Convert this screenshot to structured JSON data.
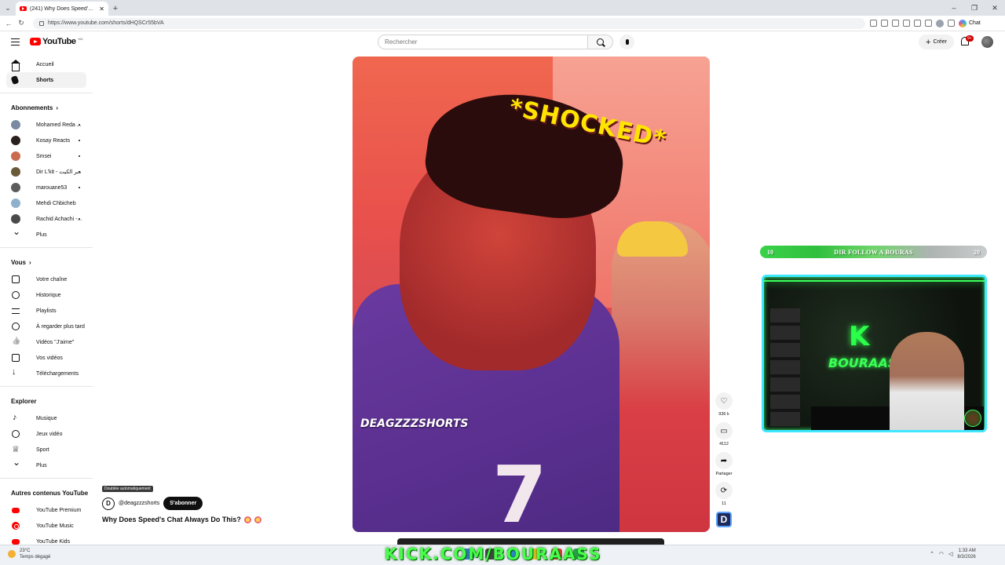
{
  "browser": {
    "tab_title": "(241) Why Does Speed's Chat Always Do This?",
    "url": "https://www.youtube.com/shorts/dHQSCr55bVA",
    "copilot_label": "Chat"
  },
  "header": {
    "logo_text": "YouTube",
    "logo_region": "MA",
    "search_placeholder": "Rechercher",
    "create_label": "Créer",
    "notif_count": "9+"
  },
  "sidebar": {
    "main": [
      {
        "label": "Accueil",
        "icon": "home-icon"
      },
      {
        "label": "Shorts",
        "icon": "shorts-icon"
      }
    ],
    "subs_heading": "Abonnements",
    "subscriptions": [
      {
        "label": "Mohamed Reda ...",
        "color": "#7a8aa0",
        "dot": true
      },
      {
        "label": "Kosay Reacts",
        "color": "#2a1f1f",
        "dot": true
      },
      {
        "label": "Smsei",
        "color": "#c86b4f",
        "dot": true
      },
      {
        "label": "Dir L'kit - دير الكيت",
        "color": "#6b5a3a",
        "dot": true
      },
      {
        "label": "marouane53",
        "color": "#5b5b5b",
        "dot": true
      },
      {
        "label": "Mehdi Chbicheb",
        "color": "#8fb0cc",
        "dot": false
      },
      {
        "label": "Rachid Achachi -...",
        "color": "#4a4a4a",
        "dot": true
      }
    ],
    "subs_more": "Plus",
    "you_heading": "Vous",
    "you_items": [
      {
        "label": "Votre chaîne",
        "icon": "person-icon"
      },
      {
        "label": "Historique",
        "icon": "history-icon"
      },
      {
        "label": "Playlists",
        "icon": "playlists-icon"
      },
      {
        "label": "À regarder plus tard",
        "icon": "clock-icon"
      },
      {
        "label": "Vidéos \"J'aime\"",
        "icon": "thumbs-up-icon"
      },
      {
        "label": "Vos vidéos",
        "icon": "video-icon"
      },
      {
        "label": "Téléchargements",
        "icon": "download-icon"
      }
    ],
    "explore_heading": "Explorer",
    "explore_items": [
      {
        "label": "Musique",
        "icon": "music-icon"
      },
      {
        "label": "Jeux vidéo",
        "icon": "gaming-icon"
      },
      {
        "label": "Sport",
        "icon": "trophy-icon"
      }
    ],
    "explore_more": "Plus",
    "other_heading": "Autres contenus YouTube",
    "other_items": [
      {
        "label": "YouTube Premium",
        "icon": "youtube-premium-icon"
      },
      {
        "label": "YouTube Music",
        "icon": "youtube-music-icon"
      },
      {
        "label": "YouTube Kids",
        "icon": "youtube-kids-icon"
      }
    ]
  },
  "short": {
    "overlay_caption": "*SHOCKED*",
    "watermark": "DEAGZZZSHORTS",
    "jersey_number": "7",
    "dub_tag": "Doublée automatiquement",
    "channel_handle": "@deagzzzshorts",
    "subscribe_label": "S'abonner",
    "title": "Why Does Speed's Chat Always Do This?",
    "likes": "936 k",
    "comments": "4112",
    "share_label": "Partager",
    "remix_count": "11"
  },
  "overlay": {
    "goal_left": "10",
    "goal_text": "DIR FOLLOW A BOURAS",
    "goal_right": "20",
    "cam_logo": "K",
    "cam_name": "BOURAASS",
    "kick_banner": "KICK.COM/BOURAASS"
  },
  "taskbar": {
    "temperature": "23°C",
    "weather_desc": "Temps dégagé",
    "time": "1:33 AM",
    "date": "8/3/2026"
  }
}
